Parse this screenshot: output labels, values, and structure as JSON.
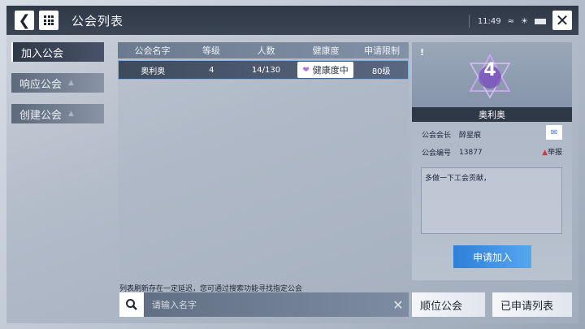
{
  "header": {
    "title": "公会列表",
    "time": "11:49",
    "back_icon": "back-arrow-icon",
    "menu_icon": "grid-icon",
    "close_icon": "close-icon"
  },
  "tabs": [
    {
      "label": "加入公会",
      "active": true
    },
    {
      "label": "响应公会",
      "active": false
    },
    {
      "label": "创建公会",
      "active": false
    }
  ],
  "table": {
    "columns": [
      "公会名字",
      "等级",
      "人数",
      "健康度",
      "申请限制"
    ],
    "rows": [
      {
        "name": "奥利奥",
        "level": "4",
        "members": "14/130",
        "health": "健康度中",
        "limit": "80级"
      }
    ]
  },
  "notice": "列表刷新存在一定延迟，您可通过搜索功能寻找指定公会",
  "search": {
    "placeholder": "请输入名字"
  },
  "guild": {
    "level": "4",
    "name": "奥利奥",
    "leader_label": "公会会长",
    "leader": "醉星痕",
    "id_label": "公会编号",
    "id": "13877",
    "report": "举报",
    "motto": "多做一下工会贡献，",
    "apply": "申请加入"
  },
  "bottom": {
    "locate": "顺位公会",
    "applied": "已申请列表"
  },
  "colors": {
    "accent": "#2e7fd8",
    "dark": "#2f3846",
    "selected_border": "#7fb0e8"
  }
}
